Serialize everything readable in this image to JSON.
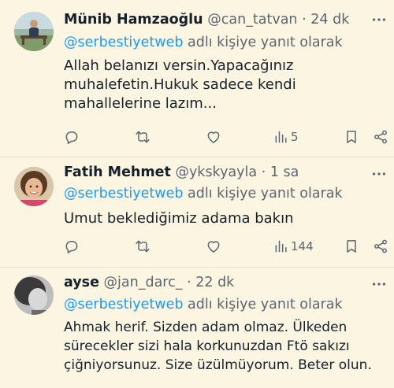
{
  "tweets": [
    {
      "name": "Münib Hamzaoğlu",
      "handle": "@can_tatvan",
      "dot": "·",
      "time": "24 dk",
      "mention": "@serbestiyetweb",
      "reply_suffix": " adlı kişiye yanıt olarak",
      "lines": [
        "Allah belanızı versin.Yapacağınız",
        "muhalefetin.Hukuk sadece kendi",
        "mahallelerine lazım..."
      ],
      "views": "5",
      "avatar": "man-on-bench-photo"
    },
    {
      "name": "Fatih Mehmet",
      "handle": "@ykskyayla",
      "dot": "·",
      "time": "1 sa",
      "mention": "@serbestiyetweb",
      "reply_suffix": " adlı kişiye yanıt olarak",
      "lines": [
        "Umut beklediğimiz adama bakın"
      ],
      "views": "144",
      "avatar": "smiling-child-photo"
    },
    {
      "name": "ayse",
      "handle": "@jan_darc_",
      "dot": "·",
      "time": "22 dk",
      "mention": "@serbestiyetweb",
      "reply_suffix": " adlı kişiye yanıt olarak",
      "lines": [
        "Ahmak herif. Sizden adam olmaz. Ülkeden",
        "sürecekler sizi hala korkunuzdan Ftö sakızı",
        "çiğniyorsunuz. Size üzülmüyorum. Beter olun."
      ],
      "avatar": "grayscale-portrait-photo"
    }
  ],
  "icons": {
    "more": "more-icon",
    "reply": "reply-icon",
    "retweet": "retweet-icon",
    "like": "heart-icon",
    "views": "views-icon",
    "bookmark": "bookmark-icon",
    "share": "share-icon"
  },
  "colors": {
    "background": "#fbf5e1",
    "text": "#15202b",
    "secondary": "#5c6670",
    "mention": "#1d9bf0",
    "divider": "#e6dfc9"
  }
}
